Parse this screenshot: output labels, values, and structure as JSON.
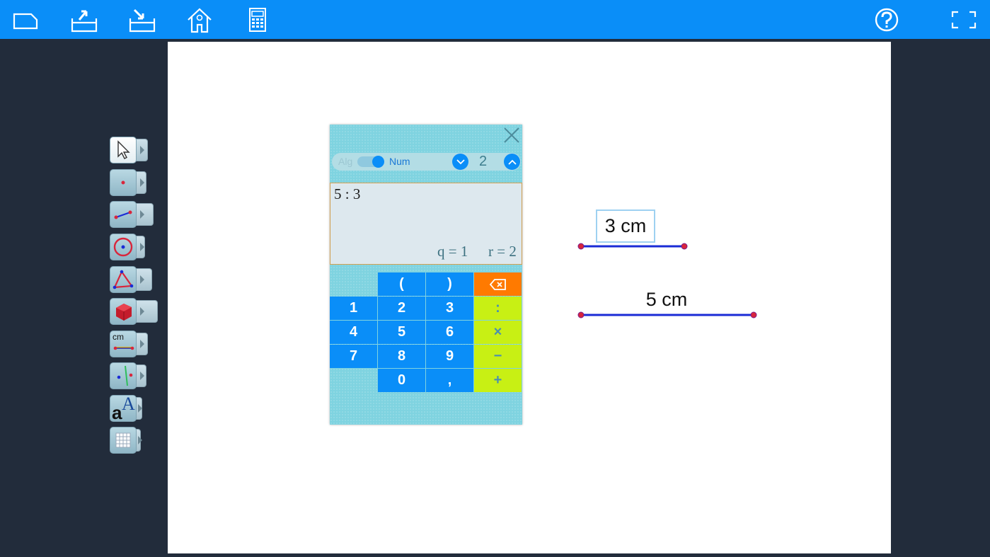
{
  "toolbar": {
    "icons": [
      "new-file-icon",
      "export-icon",
      "import-icon",
      "home-icon",
      "calculator-icon",
      "help-icon",
      "fullscreen-icon"
    ],
    "accent_color": "#0a8ef8"
  },
  "tools": {
    "items": [
      "select-tool",
      "point-tool",
      "segment-tool",
      "circle-tool",
      "polygon-tool",
      "solid-tool",
      "measure-tool",
      "line-tool",
      "text-tool",
      "grid-tool"
    ],
    "measure_unit": "cm",
    "text_tool_letters": [
      "a",
      "A"
    ]
  },
  "calculator": {
    "mode_alg": "Alg",
    "mode_num": "Num",
    "precision": "2",
    "expression": "5 : 3",
    "quotient": "q = 1",
    "remainder": "r = 2",
    "keys": {
      "open_paren": "(",
      "close_paren": ")",
      "k1": "1",
      "k2": "2",
      "k3": "3",
      "k4": "4",
      "k5": "5",
      "k6": "6",
      "k7": "7",
      "k8": "8",
      "k9": "9",
      "k0": "0",
      "comma": ",",
      "divide": ":",
      "multiply": "×",
      "minus": "−",
      "plus": "+"
    }
  },
  "drawing": {
    "segment_1_label": "3 cm",
    "segment_2_label": "5 cm",
    "segment_color": "#1a2bd6",
    "point_color": "#d8263c"
  }
}
